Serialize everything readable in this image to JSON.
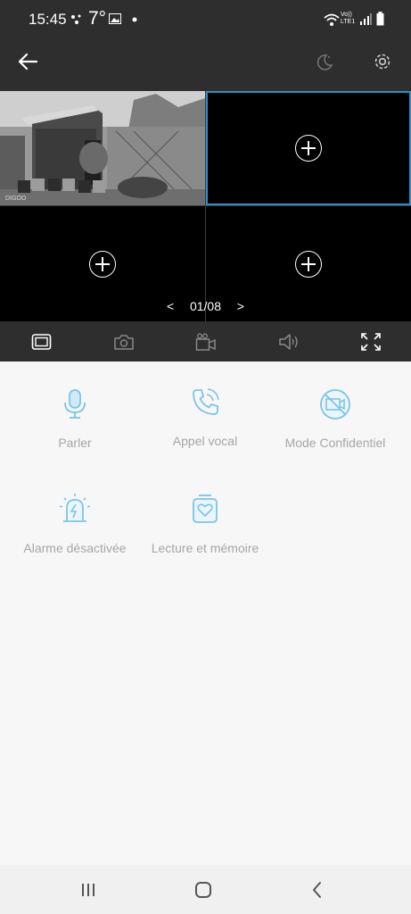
{
  "status_bar": {
    "time": "15:45",
    "temperature": "7°",
    "network_label": "Vo)) LTE1"
  },
  "app_bar": {
    "back_icon": "arrow-left-icon",
    "night_icon": "moon-icon",
    "settings_icon": "gear-icon"
  },
  "video_grid": {
    "pager": {
      "prev": "<",
      "page": "01/08",
      "next": ">"
    },
    "camera_watermark": "DIGOO"
  },
  "toolbar": {
    "items": [
      "single-view-icon",
      "snapshot-icon",
      "record-icon",
      "speaker-icon",
      "fullscreen-icon"
    ]
  },
  "features": [
    {
      "label": "Parler",
      "icon": "microphone-icon"
    },
    {
      "label": "Appel vocal",
      "icon": "phone-call-icon"
    },
    {
      "label": "Mode Confidentiel",
      "icon": "privacy-camera-off-icon"
    },
    {
      "label": "Alarme désactivée",
      "icon": "alarm-siren-icon"
    },
    {
      "label": "Lecture et mémoire",
      "icon": "playback-storage-icon"
    }
  ],
  "colors": {
    "accent": "#7cc4e8",
    "selected_border": "#2f8fc4",
    "dark_bar": "#2e2e2e",
    "label": "#a6a6a6"
  }
}
